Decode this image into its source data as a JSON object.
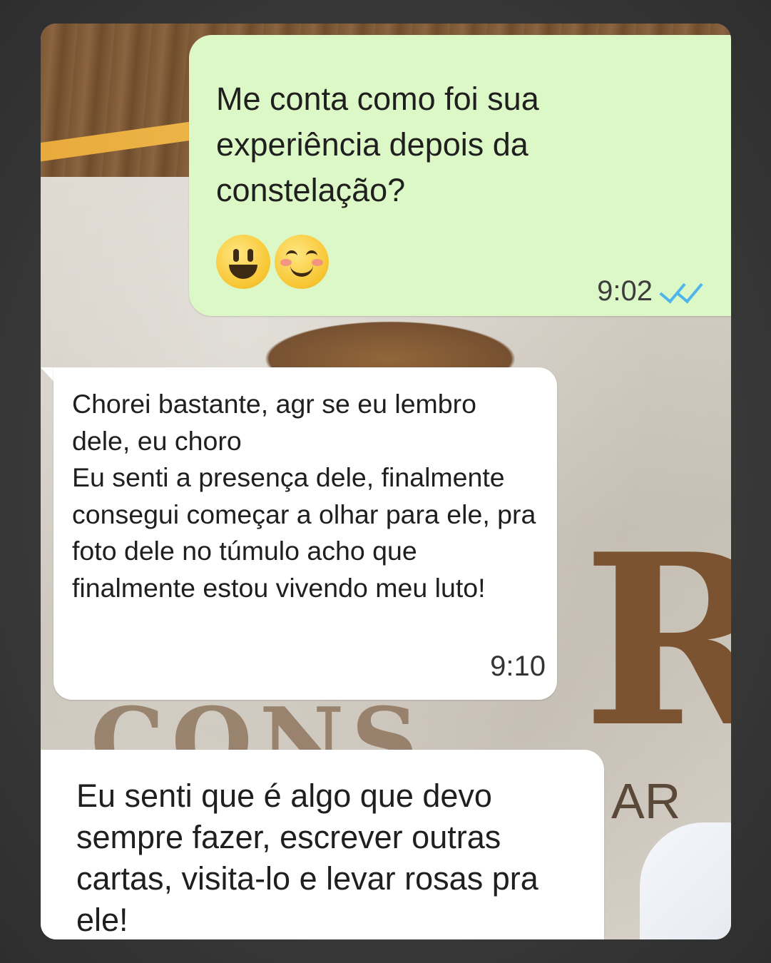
{
  "chat": {
    "outgoing": {
      "text": "Me conta como foi sua experiência depois da constelação?",
      "emojis": [
        "grinning-face",
        "smiling-face-with-smiling-eyes"
      ],
      "time": "9:02",
      "status_icon": "double-check-read-icon",
      "status_color": "#4fb6ec"
    },
    "incoming1": {
      "text": "Chorei bastante, agr se eu lembro dele, eu choro\nEu senti a presença dele, finalmente consegui começar a olhar para ele, pra foto dele no túmulo acho que finalmente estou vivendo meu luto!",
      "time": "9:10"
    },
    "incoming2": {
      "text": "Eu senti que é algo que devo sempre fazer, escrever outras cartas, visita-lo e levar rosas pra ele!"
    }
  },
  "background": {
    "big_letter": "R",
    "letters_row": "CONS",
    "small_letters": "AR"
  },
  "colors": {
    "outgoing_bubble": "#dcf8c6",
    "incoming_bubble": "#ffffff"
  }
}
